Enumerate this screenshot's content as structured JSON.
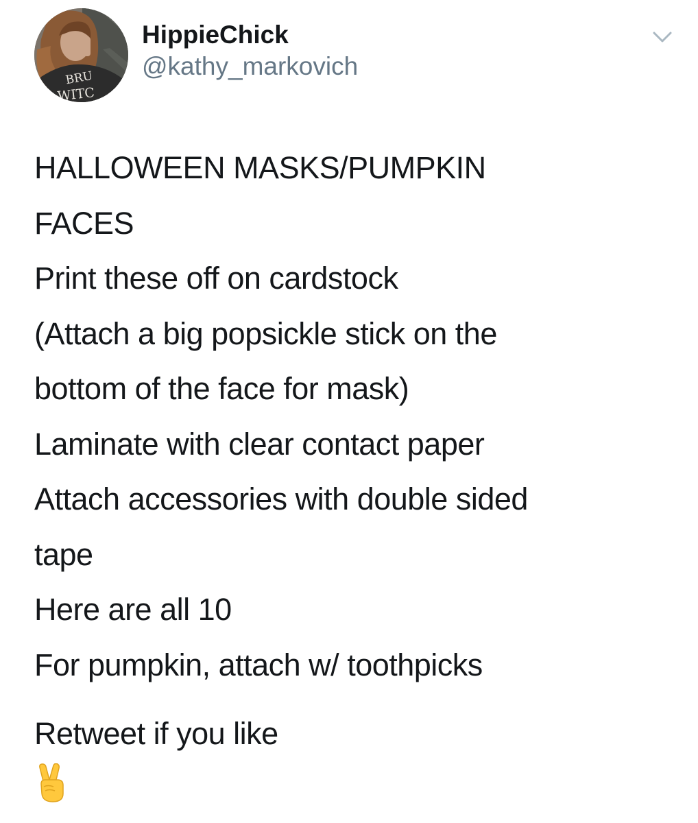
{
  "header": {
    "display_name": "HippieChick",
    "handle": "@kathy_markovich",
    "avatar_text": [
      "BRU",
      "WITC"
    ],
    "menu_icon": "chevron-down-icon"
  },
  "tweet": {
    "lines": [
      "HALLOWEEN MASKS/PUMPKIN",
      "FACES",
      "Print these off on cardstock",
      "(Attach a big popsickle stick on the",
      "bottom of the face for mask)",
      "Laminate with clear contact paper",
      "Attach accessories with double sided",
      "tape",
      "Here are all 10",
      "For pumpkin, attach w/ toothpicks"
    ],
    "closing_line": "Retweet if you like",
    "emoji": "victory-hand-emoji"
  },
  "colors": {
    "text_primary": "#14171a",
    "text_secondary": "#657786",
    "chevron": "#aab8c2",
    "background": "#ffffff"
  }
}
